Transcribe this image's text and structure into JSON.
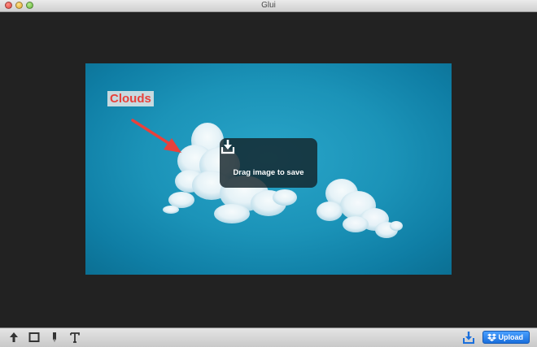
{
  "window": {
    "title": "Glui"
  },
  "image": {
    "annotation_label": "Clouds",
    "annotation_color": "#e8413b",
    "background_color": "#1b93b8"
  },
  "save_overlay": {
    "text": "Drag image to save",
    "icon": "download-tray-icon"
  },
  "toolbar": {
    "tools": [
      "arrow-tool-icon",
      "rectangle-tool-icon",
      "pen-tool-icon",
      "text-tool-icon"
    ],
    "save_icon": "save-download-icon",
    "upload_label": "Upload",
    "upload_icon": "dropbox-icon",
    "upload_color": "#1a6fdc"
  }
}
